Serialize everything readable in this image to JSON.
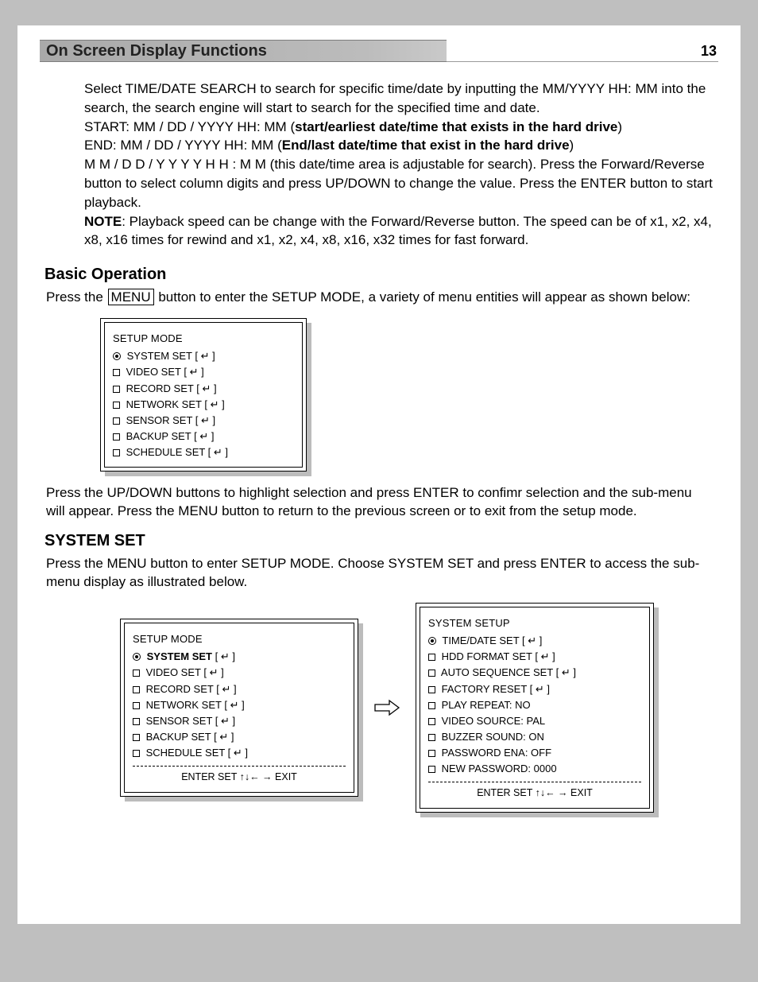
{
  "header": {
    "title": "On Screen Display Functions",
    "page": "13"
  },
  "body": {
    "p1a": "Select TIME/DATE SEARCH to search for specific time/date by inputting the MM/YYYY HH: MM into the search, the search engine will start to search for the specified time and date.",
    "p2a": "START: MM / DD / YYYY HH: MM (",
    "p2b": "start/earliest date/time that exists in the hard drive",
    "p2c": ")",
    "p3a": "END: MM / DD / YYYY HH: MM (",
    "p3b": "End/last date/time that exist in the hard drive",
    "p3c": ")",
    "p4": "M M / D D / Y Y Y Y H H : M M (this date/time area is adjustable for search). Press the Forward/Reverse button to select column digits and press UP/DOWN to change the value. Press the ENTER button to start playback.",
    "p5a": "NOTE",
    "p5b": ": Playback speed can be change with the Forward/Reverse button. The speed can be of x1, x2, x4, x8, x16 times for rewind and x1, x2, x4, x8, x16, x32 times for fast forward."
  },
  "h2_basic": "Basic Operation",
  "basic_p_a": "Press the ",
  "basic_p_box": "MENU",
  "basic_p_b": " button to enter the SETUP MODE, a variety of menu entities will appear as shown below:",
  "basic_after": "Press the UP/DOWN buttons to highlight selection and press ENTER to confimr selection and the sub-menu will appear.  Press the MENU button to return to the previous screen or to exit from the setup mode.",
  "h2_system": "SYSTEM SET",
  "system_p": "Press the MENU button to enter SETUP MODE. Choose SYSTEM SET and press ENTER to access the sub-menu display as illustrated below.",
  "menu1": {
    "title": "SETUP MODE",
    "items": [
      {
        "t": "radio",
        "sel": true,
        "bold": false,
        "label": "SYSTEM SET",
        "enter": true
      },
      {
        "t": "check",
        "label": "VIDEO SET",
        "enter": true
      },
      {
        "t": "check",
        "label": "RECORD SET",
        "enter": true
      },
      {
        "t": "check",
        "label": "NETWORK SET",
        "enter": true
      },
      {
        "t": "check",
        "label": "SENSOR SET",
        "enter": true
      },
      {
        "t": "check",
        "label": "BACKUP SET",
        "enter": true
      },
      {
        "t": "check",
        "label": "SCHEDULE SET",
        "enter": true
      }
    ]
  },
  "menu2": {
    "title": "SETUP MODE",
    "items": [
      {
        "t": "radio",
        "sel": true,
        "bold": true,
        "label": "SYSTEM SET",
        "enter": true
      },
      {
        "t": "check",
        "label": "VIDEO SET",
        "enter": true
      },
      {
        "t": "check",
        "label": "RECORD SET",
        "enter": true
      },
      {
        "t": "check",
        "label": "NETWORK SET",
        "enter": true
      },
      {
        "t": "check",
        "label": "SENSOR SET",
        "enter": true
      },
      {
        "t": "check",
        "label": "BACKUP SET",
        "enter": true
      },
      {
        "t": "check",
        "label": "SCHEDULE SET",
        "enter": true
      }
    ],
    "footer": "ENTER SET ↑↓← → EXIT"
  },
  "menu3": {
    "title": "SYSTEM SETUP",
    "items": [
      {
        "t": "radio",
        "sel": true,
        "label": "TIME/DATE SET",
        "enter": true
      },
      {
        "t": "check",
        "label": "HDD FORMAT SET",
        "enter": true
      },
      {
        "t": "check",
        "label": "AUTO SEQUENCE SET",
        "enter": true
      },
      {
        "t": "check",
        "label": "FACTORY RESET",
        "enter": true
      },
      {
        "t": "check",
        "label": "PLAY REPEAT: NO",
        "enter": false
      },
      {
        "t": "check",
        "label": "VIDEO SOURCE: PAL",
        "enter": false
      },
      {
        "t": "check",
        "label": "BUZZER SOUND: ON",
        "enter": false
      },
      {
        "t": "check",
        "label": "PASSWORD ENA: OFF",
        "enter": false
      },
      {
        "t": "check",
        "label": "NEW PASSWORD: 0000",
        "enter": false
      }
    ],
    "footer": "ENTER SET ↑↓← → EXIT"
  },
  "enter_sym": "↵"
}
